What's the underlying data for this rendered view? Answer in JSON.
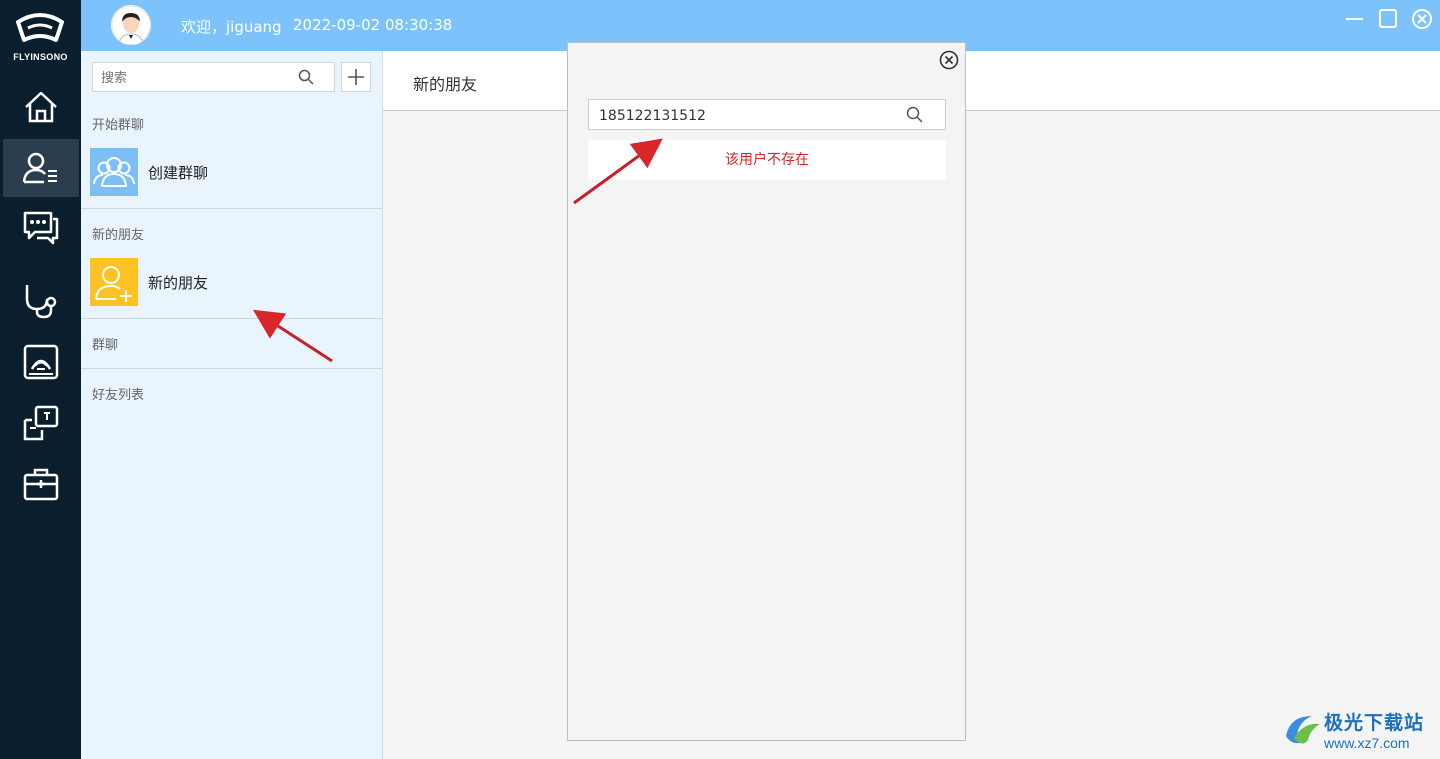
{
  "app": {
    "logo_text": "FLYINSONO",
    "welcome": "欢迎，jiguang",
    "datetime": "2022-09-02 08:30:38"
  },
  "rail": {
    "items": [
      {
        "icon": "home-icon"
      },
      {
        "icon": "contacts-icon",
        "active": true
      },
      {
        "icon": "chat-icon"
      },
      {
        "icon": "stethoscope-icon"
      },
      {
        "icon": "ultrasound-icon"
      },
      {
        "icon": "consult-icon"
      },
      {
        "icon": "toolbox-icon"
      }
    ]
  },
  "sidebar": {
    "search_placeholder": "搜索",
    "sections": {
      "start_group": "开始群聊",
      "new_friends": "新的朋友",
      "groups": "群聊",
      "friend_list": "好友列表"
    },
    "items": {
      "create_group": "创建群聊",
      "new_friend": "新的朋友"
    }
  },
  "main": {
    "title": "新的朋友"
  },
  "popup": {
    "search_value": "185122131512",
    "result_message": "该用户不存在"
  },
  "watermark": {
    "name": "极光下载站",
    "url": "www.xz7.com"
  },
  "colors": {
    "topbar": "#7cc3fb",
    "rail": "#0b1e2d",
    "sidebar": "#e9f4fd",
    "error": "#d9262b",
    "arrow": "#d9262b"
  }
}
